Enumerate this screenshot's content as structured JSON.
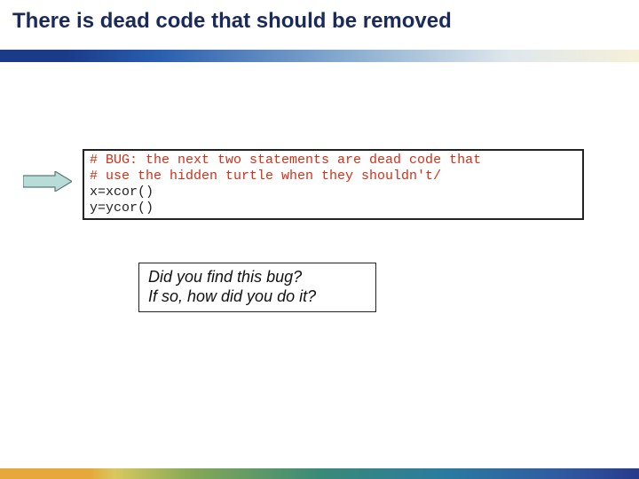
{
  "title": "There is dead code that should be removed",
  "code": {
    "comment1": "# BUG: the next two statements are dead code that",
    "comment2": "# use the hidden turtle when they shouldn't/",
    "line1": "x=xcor()",
    "line2": "y=ycor()"
  },
  "question": {
    "line1": "Did you find this bug?",
    "line2": "If so, how did you do it?"
  }
}
